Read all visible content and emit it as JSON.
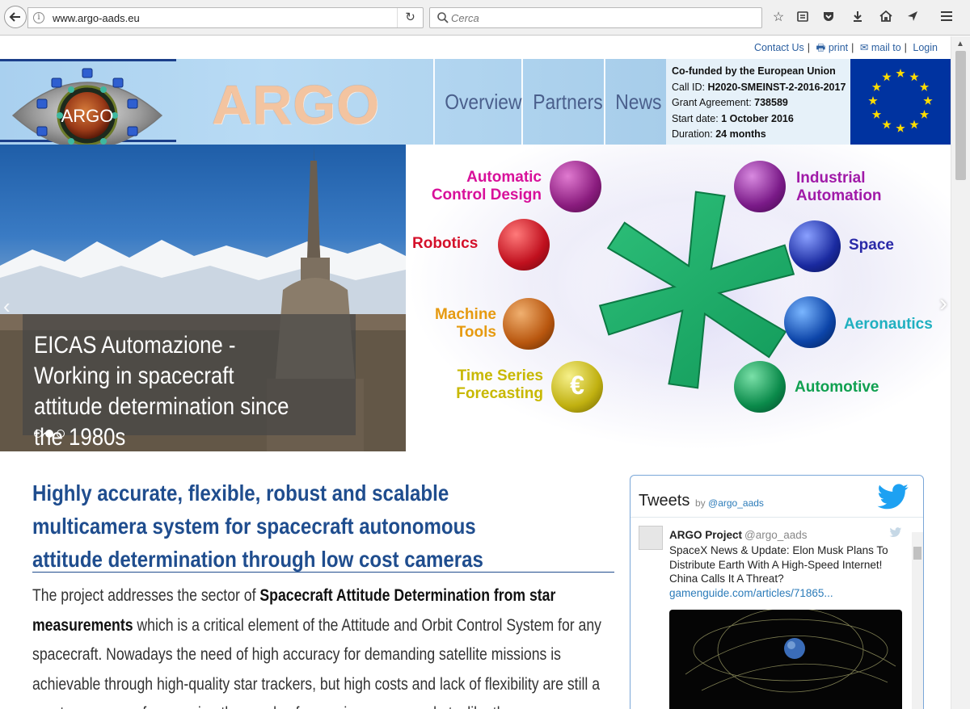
{
  "browser": {
    "url": "www.argo-aads.eu",
    "search_placeholder": "Cerca"
  },
  "util_links": {
    "contact": "Contact Us",
    "print": "print",
    "mail": "mail to",
    "login": "Login"
  },
  "header": {
    "brand": "ARGO",
    "logo_text": "ARGO",
    "nav": [
      "Overview",
      "Partners",
      "News"
    ],
    "grant": {
      "line1": "Co-funded by the European Union",
      "call_label": "Call ID:",
      "call_value": "H2020-SMEINST-2-2016-2017",
      "agreement_label": "Grant Agreement:",
      "agreement_value": "738589",
      "start_label": "Start date:",
      "start_value": "1 October 2016",
      "duration_label": "Duration:",
      "duration_value": "24 months"
    }
  },
  "hero": {
    "caption": "EICAS Automazione - Working in spacecraft attitude determination since the 1980s",
    "slides": 3,
    "active_slide": 2,
    "applications": {
      "acd1": "Automatic",
      "acd2": "Control Design",
      "rob": "Robotics",
      "mt1": "Machine",
      "mt2": "Tools",
      "ts1": "Time Series",
      "ts2": "Forecasting",
      "ia1": "Industrial",
      "ia2": "Automation",
      "space": "Space",
      "aero": "Aeronautics",
      "auto": "Automotive"
    }
  },
  "content": {
    "headline": "Highly accurate, flexible, robust and scalable multicamera system for spacecraft autonomous attitude determination through low cost cameras",
    "p_start": "The project addresses the sector of ",
    "p_bold": "Spacecraft Attitude Determination from star measurements",
    "p_rest": " which is a critical element of the Attitude and Orbit Control System for any spacecraft. Nowadays the need of high accuracy for demanding satellite missions is achievable through high-quality star trackers, but high costs and lack of flexibility are still a gap to overcome for covering the needs of emerging space markets, like the"
  },
  "tweets": {
    "title": "Tweets",
    "by": "by",
    "handle": "@argo_aads",
    "tweet_name": "ARGO Project",
    "tweet_handle": "@argo_aads",
    "tweet_text": "SpaceX News & Update: Elon Musk Plans To Distribute Earth With A High-Speed Internet! China Calls It A Threat?",
    "tweet_link": "gamenguide.com/articles/71865..."
  },
  "colors": {
    "link": "#2b5fa0",
    "headline": "#1f4d8e",
    "eu_blue": "#0033a0",
    "eu_star": "#ffdd00",
    "twitter": "#1da1f2"
  }
}
